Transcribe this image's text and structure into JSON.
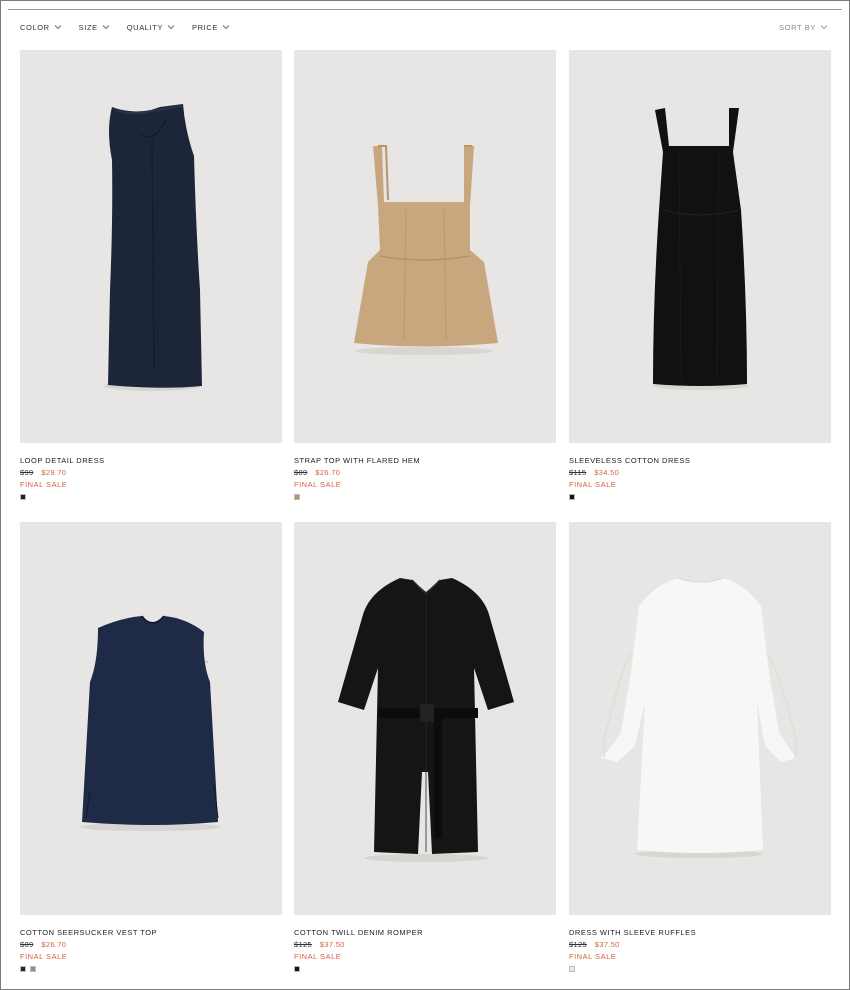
{
  "filters": [
    {
      "label": "COLOR"
    },
    {
      "label": "SIZE"
    },
    {
      "label": "QUALITY"
    },
    {
      "label": "PRICE"
    }
  ],
  "sort": {
    "label": "SORT BY"
  },
  "products": [
    {
      "name": "LOOP DETAIL DRESS",
      "old_price": "$99",
      "new_price": "$29.70",
      "sale": "FINAL SALE",
      "swatches": [
        "#1b2233"
      ],
      "image_icon": "navy-sleeveless-dress-icon"
    },
    {
      "name": "STRAP TOP WITH FLARED HEM",
      "old_price": "$89",
      "new_price": "$26.70",
      "sale": "FINAL SALE",
      "swatches": [
        "#b8926a"
      ],
      "image_icon": "beige-strap-top-icon"
    },
    {
      "name": "SLEEVELESS COTTON DRESS",
      "old_price": "$115",
      "new_price": "$34.50",
      "sale": "FINAL SALE",
      "swatches": [
        "#111111"
      ],
      "image_icon": "black-strap-dress-icon"
    },
    {
      "name": "COTTON SEERSUCKER VEST TOP",
      "old_price": "$89",
      "new_price": "$26.70",
      "sale": "FINAL SALE",
      "swatches": [
        "#1e2a44",
        "#9a8f78"
      ],
      "image_icon": "navy-vest-top-icon"
    },
    {
      "name": "COTTON TWILL DENIM ROMPER",
      "old_price": "$125",
      "new_price": "$37.50",
      "sale": "FINAL SALE",
      "swatches": [
        "#151515"
      ],
      "image_icon": "black-romper-icon"
    },
    {
      "name": "DRESS WITH SLEEVE RUFFLES",
      "old_price": "$125",
      "new_price": "$37.50",
      "sale": "FINAL SALE",
      "swatches": [
        "#e9e9e6"
      ],
      "image_icon": "white-ruffle-dress-icon"
    }
  ],
  "colors": {
    "sale_accent": "#d4623c",
    "photo_bg": "#e7e6e4"
  }
}
